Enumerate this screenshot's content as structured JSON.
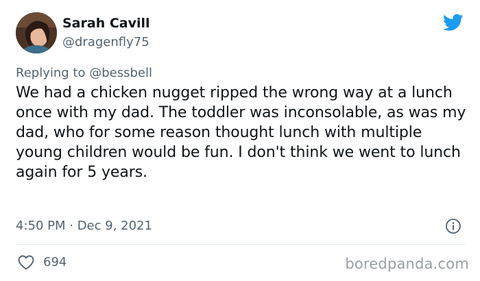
{
  "author": {
    "display_name": "Sarah Cavill",
    "handle": "@dragenfly75"
  },
  "reply": {
    "prefix": "Replying to",
    "mention": "@bessbell"
  },
  "tweet": {
    "text": "We had a chicken nugget ripped the wrong way at a lunch once with my dad. The toddler was inconsolable, as was my dad, who for some reason thought lunch with multiple young children would be fun. I don't think we went to lunch again for 5 years.",
    "timestamp": "4:50 PM · Dec 9, 2021",
    "likes": "694"
  },
  "icons": {
    "brand": "twitter-bird-icon",
    "info": "info-icon",
    "like": "heart-outline-icon"
  },
  "colors": {
    "twitter_blue": "#1d9bf0",
    "secondary_text": "#536471",
    "primary_text": "#0f1419"
  },
  "watermark": "boredpanda.com"
}
